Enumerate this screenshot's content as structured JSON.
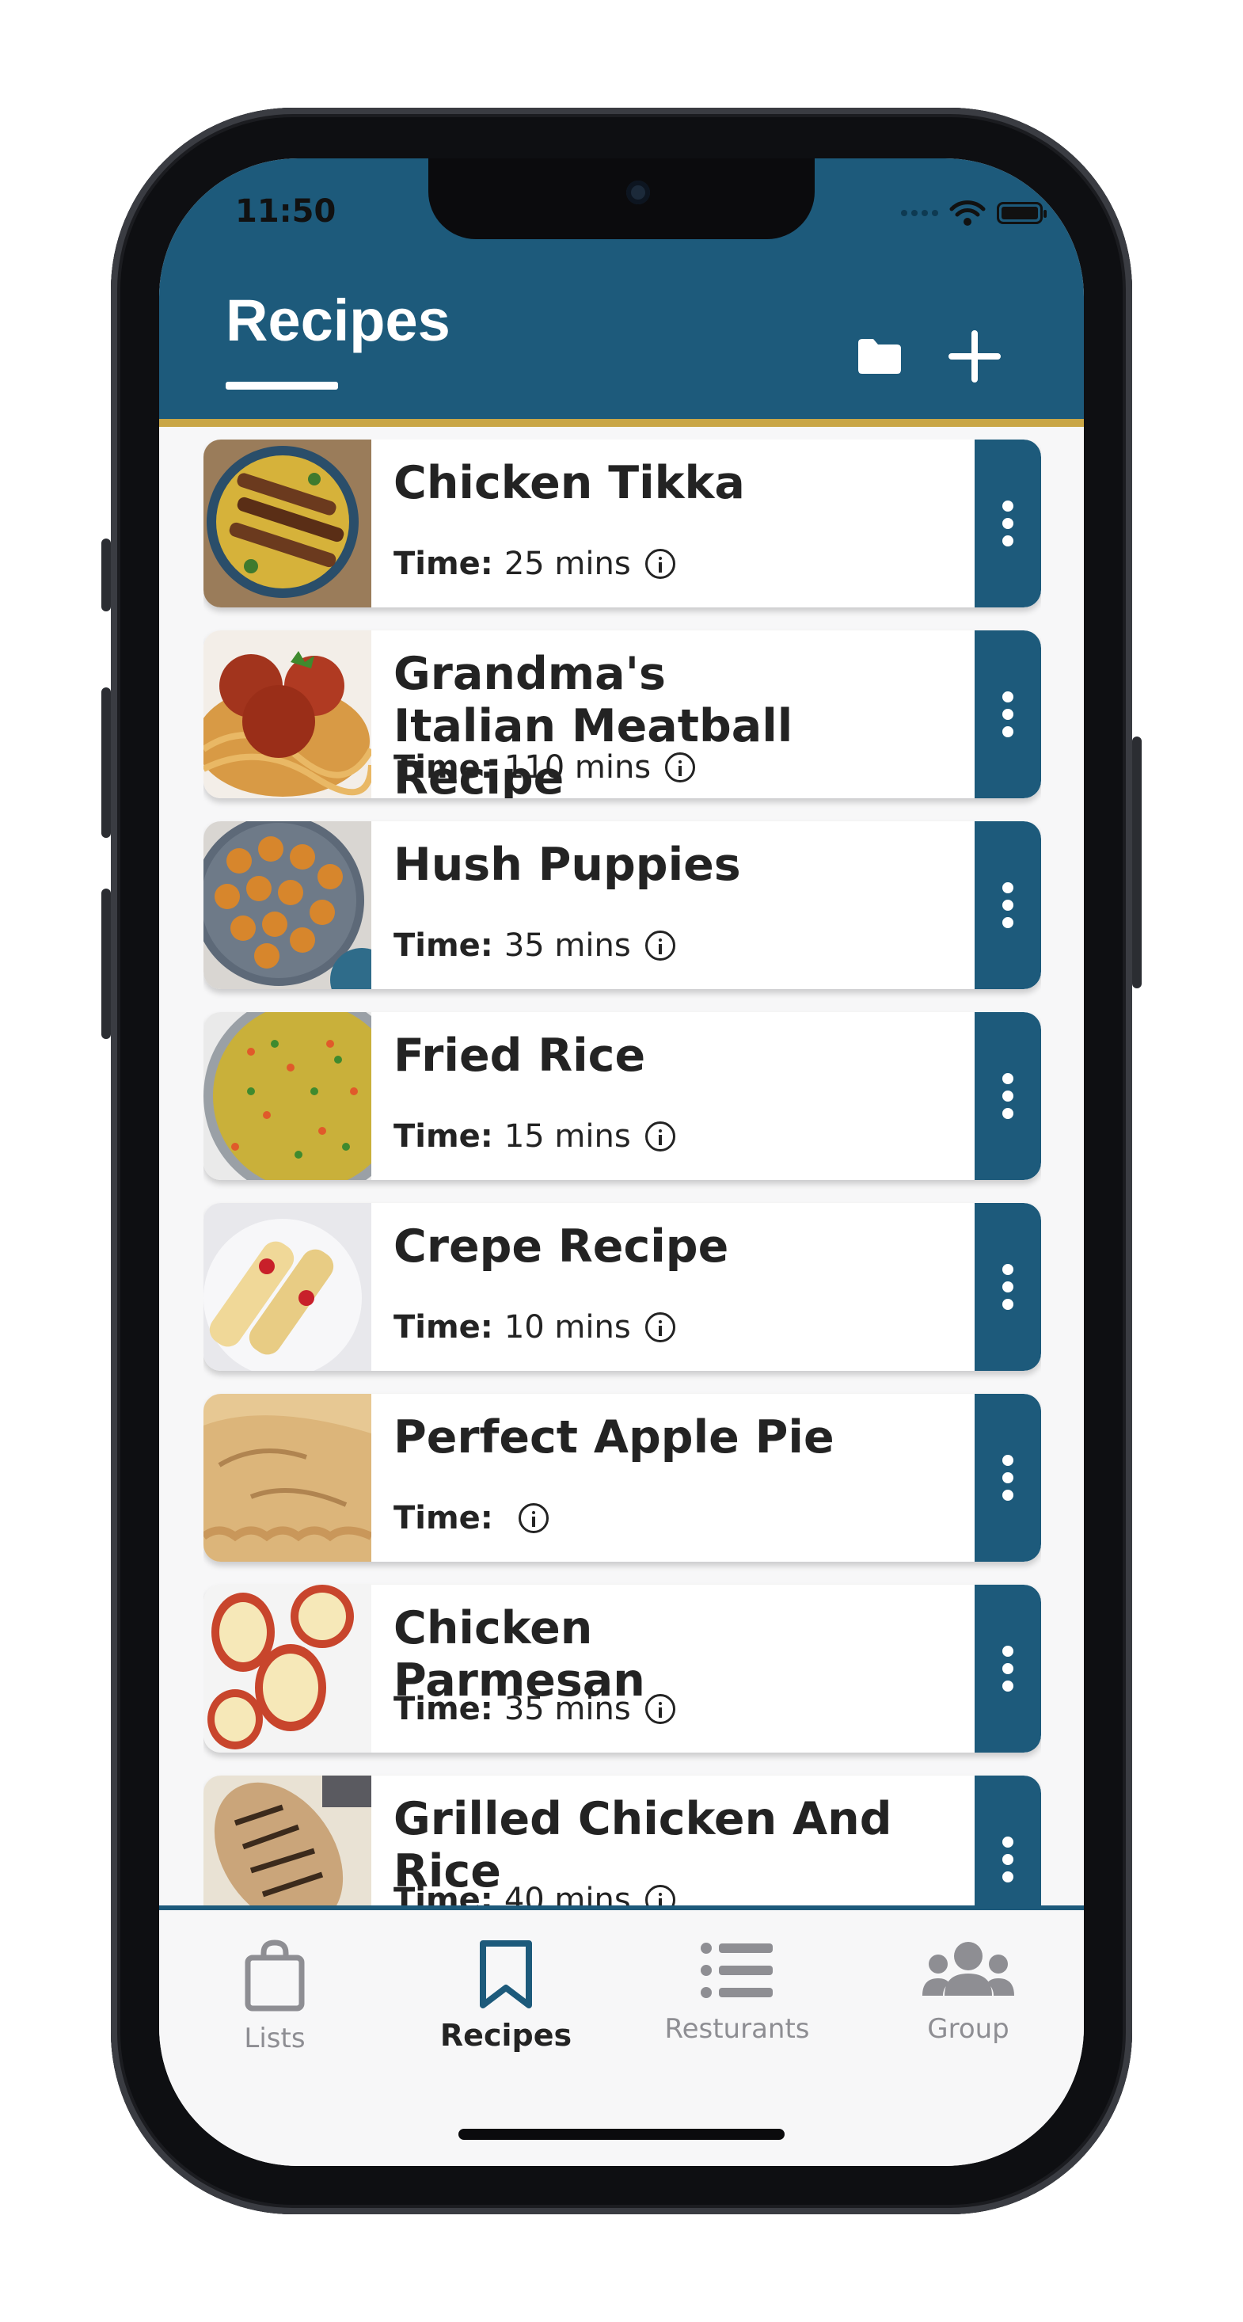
{
  "status_bar": {
    "time": "11:50"
  },
  "header": {
    "title": "Recipes"
  },
  "colors": {
    "brand": "#1d5a7b",
    "accent": "#c9a646"
  },
  "recipes": [
    {
      "name": "Chicken Tikka",
      "time_label": "Time:",
      "time_value": "25 mins"
    },
    {
      "name": "Grandma's Italian Meatball Recipe",
      "time_label": "Time:",
      "time_value": "110 mins"
    },
    {
      "name": "Hush Puppies",
      "time_label": "Time:",
      "time_value": "35 mins"
    },
    {
      "name": "Fried Rice",
      "time_label": "Time:",
      "time_value": "15 mins"
    },
    {
      "name": "Crepe Recipe",
      "time_label": "Time:",
      "time_value": "10 mins"
    },
    {
      "name": "Perfect Apple Pie",
      "time_label": "Time:",
      "time_value": ""
    },
    {
      "name": "Chicken Parmesan",
      "time_label": "Time:",
      "time_value": "35 mins"
    },
    {
      "name": "Grilled Chicken And Rice",
      "time_label": "Time:",
      "time_value": "40 mins"
    }
  ],
  "tabbar": {
    "tabs": [
      {
        "label": "Lists",
        "icon": "shopping-bag-icon"
      },
      {
        "label": "Recipes",
        "icon": "bookmark-icon"
      },
      {
        "label": "Resturants",
        "icon": "list-icon"
      },
      {
        "label": "Group",
        "icon": "group-icon"
      }
    ],
    "active": "Recipes"
  }
}
